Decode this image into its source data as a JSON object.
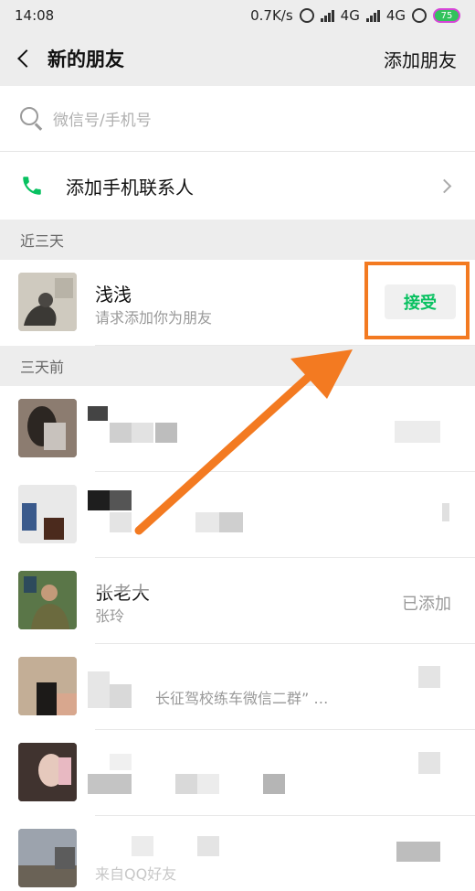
{
  "statusbar": {
    "time": "14:08",
    "net_speed": "0.7K/s",
    "net1": "4G",
    "net2": "4G",
    "battery": "75"
  },
  "navbar": {
    "title": "新的朋友",
    "action": "添加朋友"
  },
  "search": {
    "placeholder": "微信号/手机号"
  },
  "add_phone": {
    "label": "添加手机联系人"
  },
  "sections": {
    "recent": "近三天",
    "older": "三天前"
  },
  "requests": [
    {
      "name": "浅浅",
      "message": "请求添加你为朋友",
      "action": "接受"
    },
    {
      "name": "",
      "message": "",
      "status": ""
    },
    {
      "name": "",
      "message": "",
      "status": ""
    },
    {
      "name": "张老大",
      "message": "张玲",
      "status": "已添加"
    },
    {
      "name": "",
      "message": "长征驾校练车微信二群” …",
      "status": ""
    },
    {
      "name": "",
      "message": "",
      "status": ""
    },
    {
      "name": "",
      "message": "来自QQ好友",
      "status": ""
    }
  ],
  "colors": {
    "accent_green": "#07c160",
    "highlight_orange": "#f37a21",
    "background": "#ededed"
  }
}
